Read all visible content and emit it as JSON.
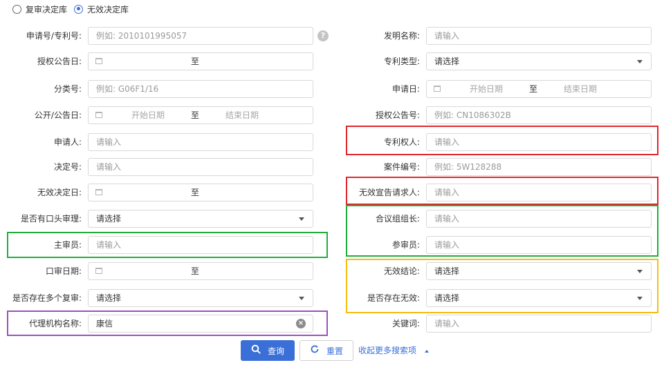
{
  "db_options": [
    {
      "label": "复审决定库",
      "selected": false
    },
    {
      "label": "无效决定库",
      "selected": true
    }
  ],
  "left_fields": [
    {
      "key": "app_no",
      "label": "申请号/专利号:",
      "type": "text",
      "placeholder": "例如: 2010101995057",
      "value": "",
      "help": true
    },
    {
      "key": "grant_date",
      "label": "授权公告日:",
      "type": "daterange",
      "sep": "至",
      "start_ph": "",
      "end_ph": ""
    },
    {
      "key": "class_no",
      "label": "分类号:",
      "type": "text",
      "placeholder": "例如: G06F1/16",
      "value": ""
    },
    {
      "key": "pub_date",
      "label": "公开/公告日:",
      "type": "daterange",
      "sep": "至",
      "start_ph": "开始日期",
      "end_ph": "结束日期"
    },
    {
      "key": "applicant",
      "label": "申请人:",
      "type": "text",
      "placeholder": "请输入",
      "value": ""
    },
    {
      "key": "decision_no",
      "label": "决定号:",
      "type": "text",
      "placeholder": "请输入",
      "value": ""
    },
    {
      "key": "invalid_date",
      "label": "无效决定日:",
      "type": "daterange",
      "sep": "至",
      "start_ph": "",
      "end_ph": ""
    },
    {
      "key": "oral_hearing",
      "label": "是否有口头审理:",
      "type": "select",
      "value": "请选择"
    },
    {
      "key": "chief_examiner",
      "label": "主审员:",
      "type": "text",
      "placeholder": "请输入",
      "value": ""
    },
    {
      "key": "oral_date",
      "label": "口审日期:",
      "type": "daterange",
      "sep": "至",
      "start_ph": "",
      "end_ph": ""
    },
    {
      "key": "multi_review",
      "label": "是否存在多个复审:",
      "type": "select",
      "value": "请选择"
    },
    {
      "key": "agency",
      "label": "代理机构名称:",
      "type": "text",
      "placeholder": "",
      "value": "康信",
      "clearable": true
    }
  ],
  "right_fields": [
    {
      "key": "invention_name",
      "label": "发明名称:",
      "type": "text",
      "placeholder": "请输入",
      "value": ""
    },
    {
      "key": "patent_type",
      "label": "专利类型:",
      "type": "select",
      "value": "请选择"
    },
    {
      "key": "apply_date",
      "label": "申请日:",
      "type": "daterange",
      "sep": "至",
      "start_ph": "开始日期",
      "end_ph": "结束日期"
    },
    {
      "key": "grant_no",
      "label": "授权公告号:",
      "type": "text",
      "placeholder": "例如: CN1086302B",
      "value": ""
    },
    {
      "key": "patentee",
      "label": "专利权人:",
      "type": "text",
      "placeholder": "请输入",
      "value": ""
    },
    {
      "key": "case_no",
      "label": "案件编号:",
      "type": "text",
      "placeholder": "例如: 5W128288",
      "value": ""
    },
    {
      "key": "requester",
      "label": "无效宣告请求人:",
      "type": "text",
      "placeholder": "请输入",
      "value": ""
    },
    {
      "key": "panel_leader",
      "label": "合议组组长:",
      "type": "text",
      "placeholder": "请输入",
      "value": ""
    },
    {
      "key": "panel_member",
      "label": "参审员:",
      "type": "text",
      "placeholder": "请输入",
      "value": ""
    },
    {
      "key": "conclusion",
      "label": "无效结论:",
      "type": "select",
      "value": "请选择"
    },
    {
      "key": "has_invalid",
      "label": "是否存在无效:",
      "type": "select",
      "value": "请选择"
    },
    {
      "key": "keyword",
      "label": "关键词:",
      "type": "text",
      "placeholder": "请输入",
      "value": ""
    }
  ],
  "actions": {
    "search": "查询",
    "reset": "重置",
    "collapse": "收起更多搜索项"
  },
  "help_icon_glyph": "?",
  "clear_icon_glyph": "×",
  "highlight_colors": {
    "red": "#e0262d",
    "green": "#1fae3c",
    "purple": "#9b4fc0",
    "yellow": "#f5bd12"
  },
  "accent_color": "#3a6fd8"
}
